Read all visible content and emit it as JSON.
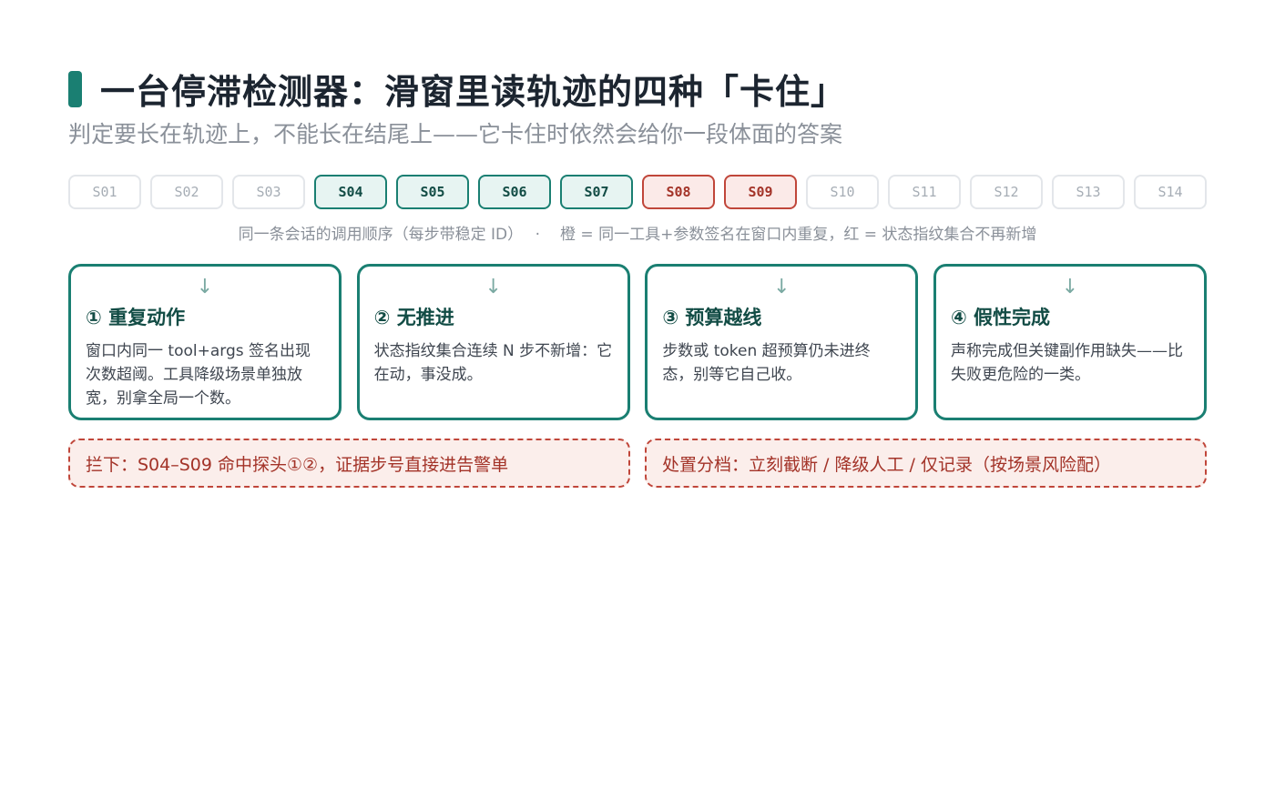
{
  "header": {
    "title": "一台停滞检测器：滑窗里读轨迹的四种「卡住」",
    "subtitle": "判定要长在轨迹上，不能长在结尾上——它卡住时依然会给你一段体面的答案"
  },
  "steps": [
    {
      "label": "S01",
      "state": "normal"
    },
    {
      "label": "S02",
      "state": "normal"
    },
    {
      "label": "S03",
      "state": "normal"
    },
    {
      "label": "S04",
      "state": "repeat"
    },
    {
      "label": "S05",
      "state": "repeat"
    },
    {
      "label": "S06",
      "state": "repeat"
    },
    {
      "label": "S07",
      "state": "repeat"
    },
    {
      "label": "S08",
      "state": "no-new-state"
    },
    {
      "label": "S09",
      "state": "no-new-state"
    },
    {
      "label": "S10",
      "state": "normal"
    },
    {
      "label": "S11",
      "state": "normal"
    },
    {
      "label": "S12",
      "state": "normal"
    },
    {
      "label": "S13",
      "state": "normal"
    },
    {
      "label": "S14",
      "state": "normal"
    }
  ],
  "legend": {
    "left": "同一条会话的调用顺序（每步带稳定 ID）",
    "separator": "·",
    "right": "橙 = 同一工具+参数签名在窗口内重复，红 = 状态指纹集合不再新增"
  },
  "cards": [
    {
      "arrow": "↓",
      "title": "① 重复动作",
      "body": "窗口内同一 tool+args 签名出现次数超阈。工具降级场景单独放宽，别拿全局一个数。"
    },
    {
      "arrow": "↓",
      "title": "② 无推进",
      "body": "状态指纹集合连续 N 步不新增：它在动，事没成。"
    },
    {
      "arrow": "↓",
      "title": "③ 预算越线",
      "body": "步数或 token 超预算仍未进终态，别等它自己收。"
    },
    {
      "arrow": "↓",
      "title": "④ 假性完成",
      "body": "声称完成但关键副作用缺失——比失败更危险的一类。"
    }
  ],
  "notes": [
    {
      "text": "拦下：S04–S09 命中探头①②，证据步号直接进告警单"
    },
    {
      "text": "处置分档：立刻截断 / 降级人工 / 仅记录（按场景风险配）"
    }
  ],
  "colors": {
    "accent": "#1a7f72",
    "accent_fill": "#e7f4f2",
    "alert": "#c0463a",
    "alert_fill": "#fbeae8",
    "muted": "#8a9099"
  }
}
